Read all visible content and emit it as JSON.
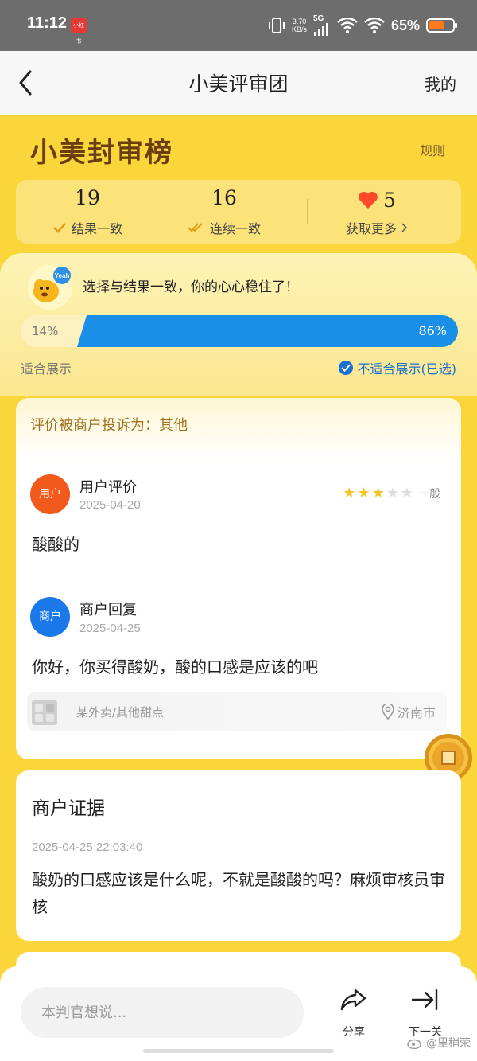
{
  "status_bar": {
    "time": "11:12",
    "app_badge": "小红书",
    "net_speed_value": "3.70",
    "net_speed_unit": "KB/s",
    "network": "5G",
    "battery": "65%",
    "battery_level": 0.65
  },
  "nav": {
    "title": "小美评审团",
    "right_label": "我的"
  },
  "banner": {
    "title": "小美封审榜",
    "rules": "规则"
  },
  "stats": [
    {
      "value": "19",
      "label": "结果一致"
    },
    {
      "value": "16",
      "label": "连续一致"
    },
    {
      "value": "5",
      "label": "获取更多"
    }
  ],
  "vote": {
    "message": "选择与结果一致，你的心心稳住了！",
    "mascot_text": "Yeah",
    "left_pct": "14%",
    "right_pct": "86%",
    "left_fraction": 0.14,
    "right_fraction": 0.86,
    "left_option": "适合展示",
    "right_option": "不适合展示(已选)"
  },
  "review": {
    "complaint": "评价被商户投诉为：其他",
    "user": {
      "avatar_label": "用户",
      "title": "用户评价",
      "date": "2025-04-20",
      "rating": 3,
      "rating_max": 5,
      "rating_text": "一般",
      "content": "酸酸的"
    },
    "merchant": {
      "avatar_label": "商户",
      "title": "商户回复",
      "date": "2025-04-25",
      "content": "你好，你买得酸奶，酸的口感是应该的吧"
    },
    "shop": {
      "name": "某外卖/其他甜点",
      "location": "济南市"
    }
  },
  "evidence": {
    "title": "商户证据",
    "datetime": "2025-04-25 22:03:40",
    "text": "酸奶的口感应该是什么呢，不就是酸酸的吗？麻烦审核员审核"
  },
  "bottom": {
    "input_placeholder": "本判官想说...",
    "share_label": "分享",
    "next_label": "下一关"
  },
  "watermark": "@里稍荣",
  "colors": {
    "accent_blue": "#1a8fe8",
    "brand_yellow": "#fbd63a",
    "user_avatar": "#f2591c",
    "merchant_avatar": "#1a78e8",
    "heart": "#ff4a2a",
    "star_on": "#f6c327",
    "star_off": "#dcdcdc"
  }
}
